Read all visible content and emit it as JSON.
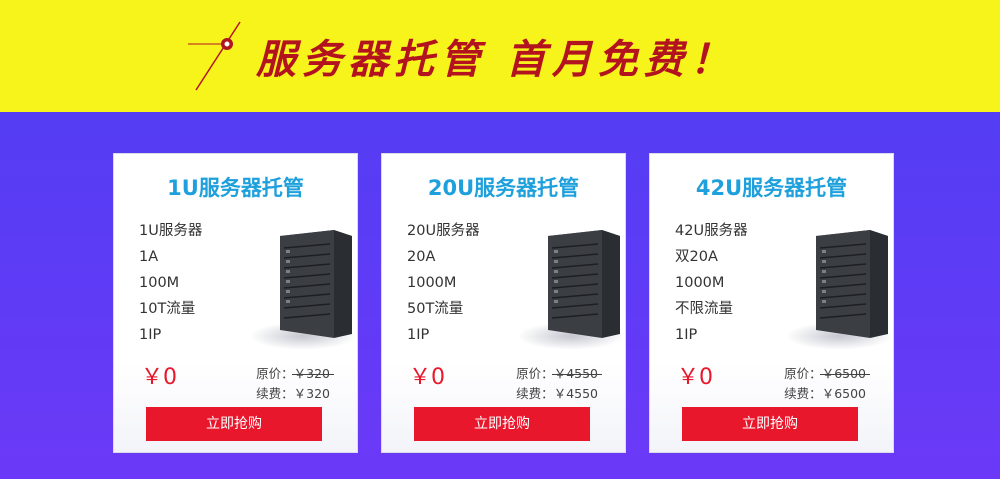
{
  "banner": {
    "title": "服务器托管  首月免费！",
    "accent_color": "#b3131f",
    "background_color": "#f7f41c"
  },
  "plans": [
    {
      "title": "1U服务器托管",
      "specs": [
        "1U服务器",
        "1A",
        "100M",
        "10T流量",
        "1IP"
      ],
      "price": "￥0",
      "original_label": "原价：",
      "original_value": "￥320",
      "renew_label": "续费：",
      "renew_value": "￥320",
      "button_label": "立即抢购",
      "image_icon": "server-rack-icon"
    },
    {
      "title": "20U服务器托管",
      "specs": [
        "20U服务器",
        "20A",
        "1000M",
        "50T流量",
        "1IP"
      ],
      "price": "￥0",
      "original_label": "原价：",
      "original_value": "￥4550",
      "renew_label": "续费：",
      "renew_value": "￥4550",
      "button_label": "立即抢购",
      "image_icon": "server-rack-icon"
    },
    {
      "title": "42U服务器托管",
      "specs": [
        "42U服务器",
        "双20A",
        "1000M",
        "不限流量",
        "1IP"
      ],
      "price": "￥0",
      "original_label": "原价：",
      "original_value": "￥6500",
      "renew_label": "续费：",
      "renew_value": "￥6500",
      "button_label": "立即抢购",
      "image_icon": "server-rack-icon"
    }
  ],
  "colors": {
    "title_blue": "#1ea0dc",
    "price_red": "#e8172c",
    "button_red": "#e8172c",
    "background_blue": "#4d3ff0"
  }
}
